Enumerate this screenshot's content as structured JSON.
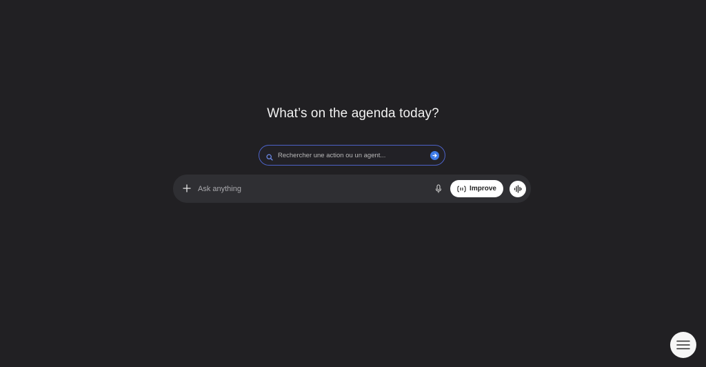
{
  "main": {
    "heading": "What’s on the agenda today?"
  },
  "search": {
    "placeholder": "Rechercher une action ou un agent...",
    "border_color": "#4d63c9",
    "submit_color": "#3e7ce8",
    "icons": {
      "search": "search-icon",
      "submit": "arrow-right-icon"
    }
  },
  "composer": {
    "placeholder": "Ask anything",
    "improve_label": "Improve",
    "icons": {
      "add": "plus-icon",
      "mic": "microphone-icon",
      "improve": "braces-icon",
      "voice": "voice-waveform-icon"
    }
  },
  "floating_menu": {
    "icon": "hamburger-menu-icon"
  },
  "colors": {
    "background": "#212023",
    "composer_bg": "#2f2f33",
    "text": "#f2f2f2"
  }
}
